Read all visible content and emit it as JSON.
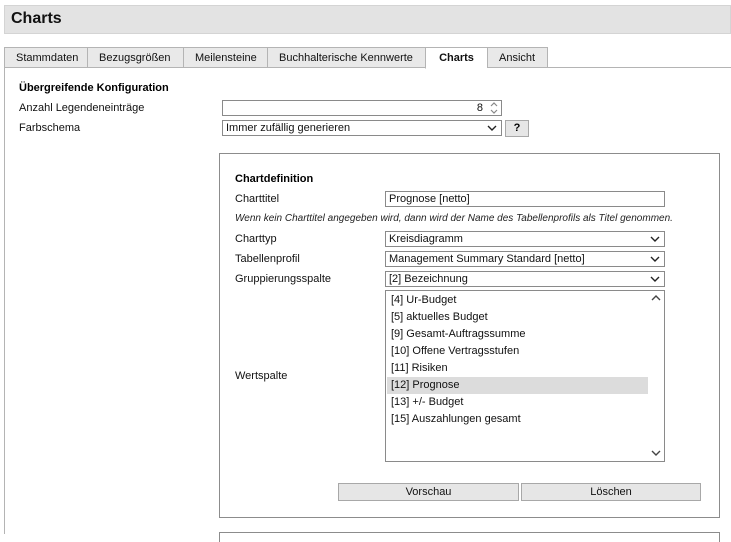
{
  "page": {
    "title": "Charts"
  },
  "tabs": [
    {
      "label": "Stammdaten"
    },
    {
      "label": "Bezugsgrößen"
    },
    {
      "label": "Meilensteine"
    },
    {
      "label": "Buchhalterische Kennwerte"
    },
    {
      "label": "Charts",
      "active": true
    },
    {
      "label": "Ansicht"
    }
  ],
  "global_config": {
    "title": "Übergreifende Konfiguration",
    "legend_label": "Anzahl Legendeneinträge",
    "legend_value": "8",
    "color_label": "Farbschema",
    "color_value": "Immer zufällig generieren",
    "help_button": "?"
  },
  "chart_definition": {
    "title": "Chartdefinition",
    "charttitle_label": "Charttitel",
    "charttitle_value": "Prognose [netto]",
    "hint": "Wenn kein Charttitel angegeben wird, dann wird der Name des Tabellenprofils als Titel genommen.",
    "charttype_label": "Charttyp",
    "charttype_value": "Kreisdiagramm",
    "profile_label": "Tabellenprofil",
    "profile_value": "Management Summary Standard [netto]",
    "grouping_label": "Gruppierungsspalte",
    "grouping_value": "[2] Bezeichnung",
    "value_col_label": "Wertspalte",
    "value_columns": [
      {
        "label": "[4] Ur-Budget",
        "selected": false
      },
      {
        "label": "[5] aktuelles Budget",
        "selected": false
      },
      {
        "label": "[9] Gesamt-Auftragssumme",
        "selected": false
      },
      {
        "label": "[10] Offene Vertragsstufen",
        "selected": false
      },
      {
        "label": "[11] Risiken",
        "selected": false
      },
      {
        "label": "[12] Prognose",
        "selected": true
      },
      {
        "label": "[13] +/- Budget",
        "selected": false
      },
      {
        "label": "[15] Auszahlungen gesamt",
        "selected": false
      }
    ],
    "preview_button": "Vorschau",
    "delete_button": "Löschen"
  },
  "icons": {
    "dropdown": "chevron-down-icon",
    "spinner": "spinner-icon",
    "scroll_up": "chevron-up-icon",
    "scroll_down": "chevron-down-icon"
  }
}
